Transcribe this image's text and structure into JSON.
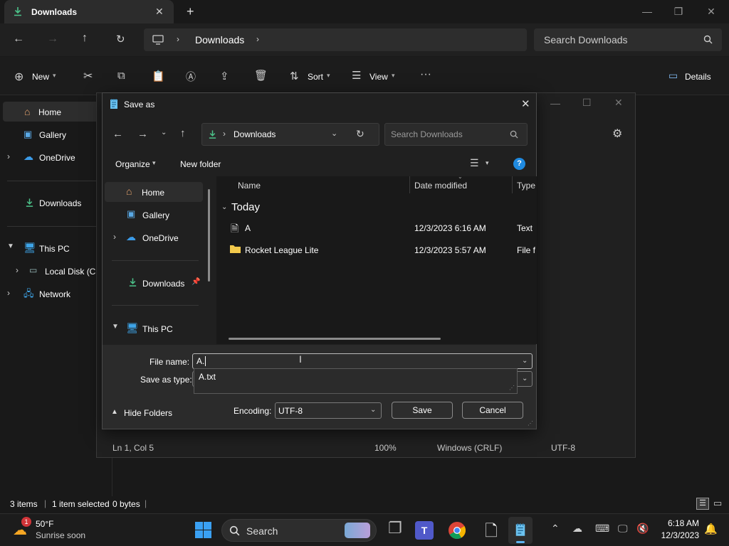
{
  "explorer": {
    "tab_title": "Downloads",
    "address": [
      "Downloads"
    ],
    "search_placeholder": "Search Downloads",
    "toolbar": {
      "new": "New",
      "sort": "Sort",
      "view": "View",
      "details": "Details"
    },
    "nav": {
      "home": "Home",
      "gallery": "Gallery",
      "onedrive": "OneDrive",
      "downloads": "Downloads",
      "thispc": "This PC",
      "localdisk": "Local Disk (C:",
      "network": "Network"
    },
    "status": {
      "items": "3 items",
      "selected": "1 item selected",
      "size": "0 bytes"
    }
  },
  "notepad": {
    "status": {
      "position": "Ln 1, Col 5",
      "zoom": "100%",
      "line_ending": "Windows (CRLF)",
      "encoding": "UTF-8"
    }
  },
  "dialog": {
    "title": "Save as",
    "address": "Downloads",
    "search_placeholder": "Search Downloads",
    "organize": "Organize",
    "new_folder": "New folder",
    "sidebar": {
      "home": "Home",
      "gallery": "Gallery",
      "onedrive": "OneDrive",
      "downloads": "Downloads",
      "thispc": "This PC"
    },
    "columns": {
      "name": "Name",
      "date": "Date modified",
      "type": "Type"
    },
    "group": "Today",
    "files": [
      {
        "name": "A",
        "date": "12/3/2023 6:16 AM",
        "type": "Text D"
      },
      {
        "name": "Rocket League Lite",
        "date": "12/3/2023 5:57 AM",
        "type": "File fo"
      }
    ],
    "file_name_label": "File name:",
    "file_name_value": "A.",
    "autocomplete": "A.txt",
    "save_type_label": "Save as type:",
    "hide_folders": "Hide Folders",
    "encoding_label": "Encoding:",
    "encoding_value": "UTF-8",
    "save": "Save",
    "cancel": "Cancel"
  },
  "taskbar": {
    "weather_temp": "50°F",
    "weather_desc": "Sunrise soon",
    "weather_badge": "1",
    "search": "Search",
    "time": "6:18 AM",
    "date": "12/3/2023"
  },
  "colors": {
    "accent": "#0078d4",
    "folder": "#f2c94c",
    "download_green": "#4cc38a"
  }
}
